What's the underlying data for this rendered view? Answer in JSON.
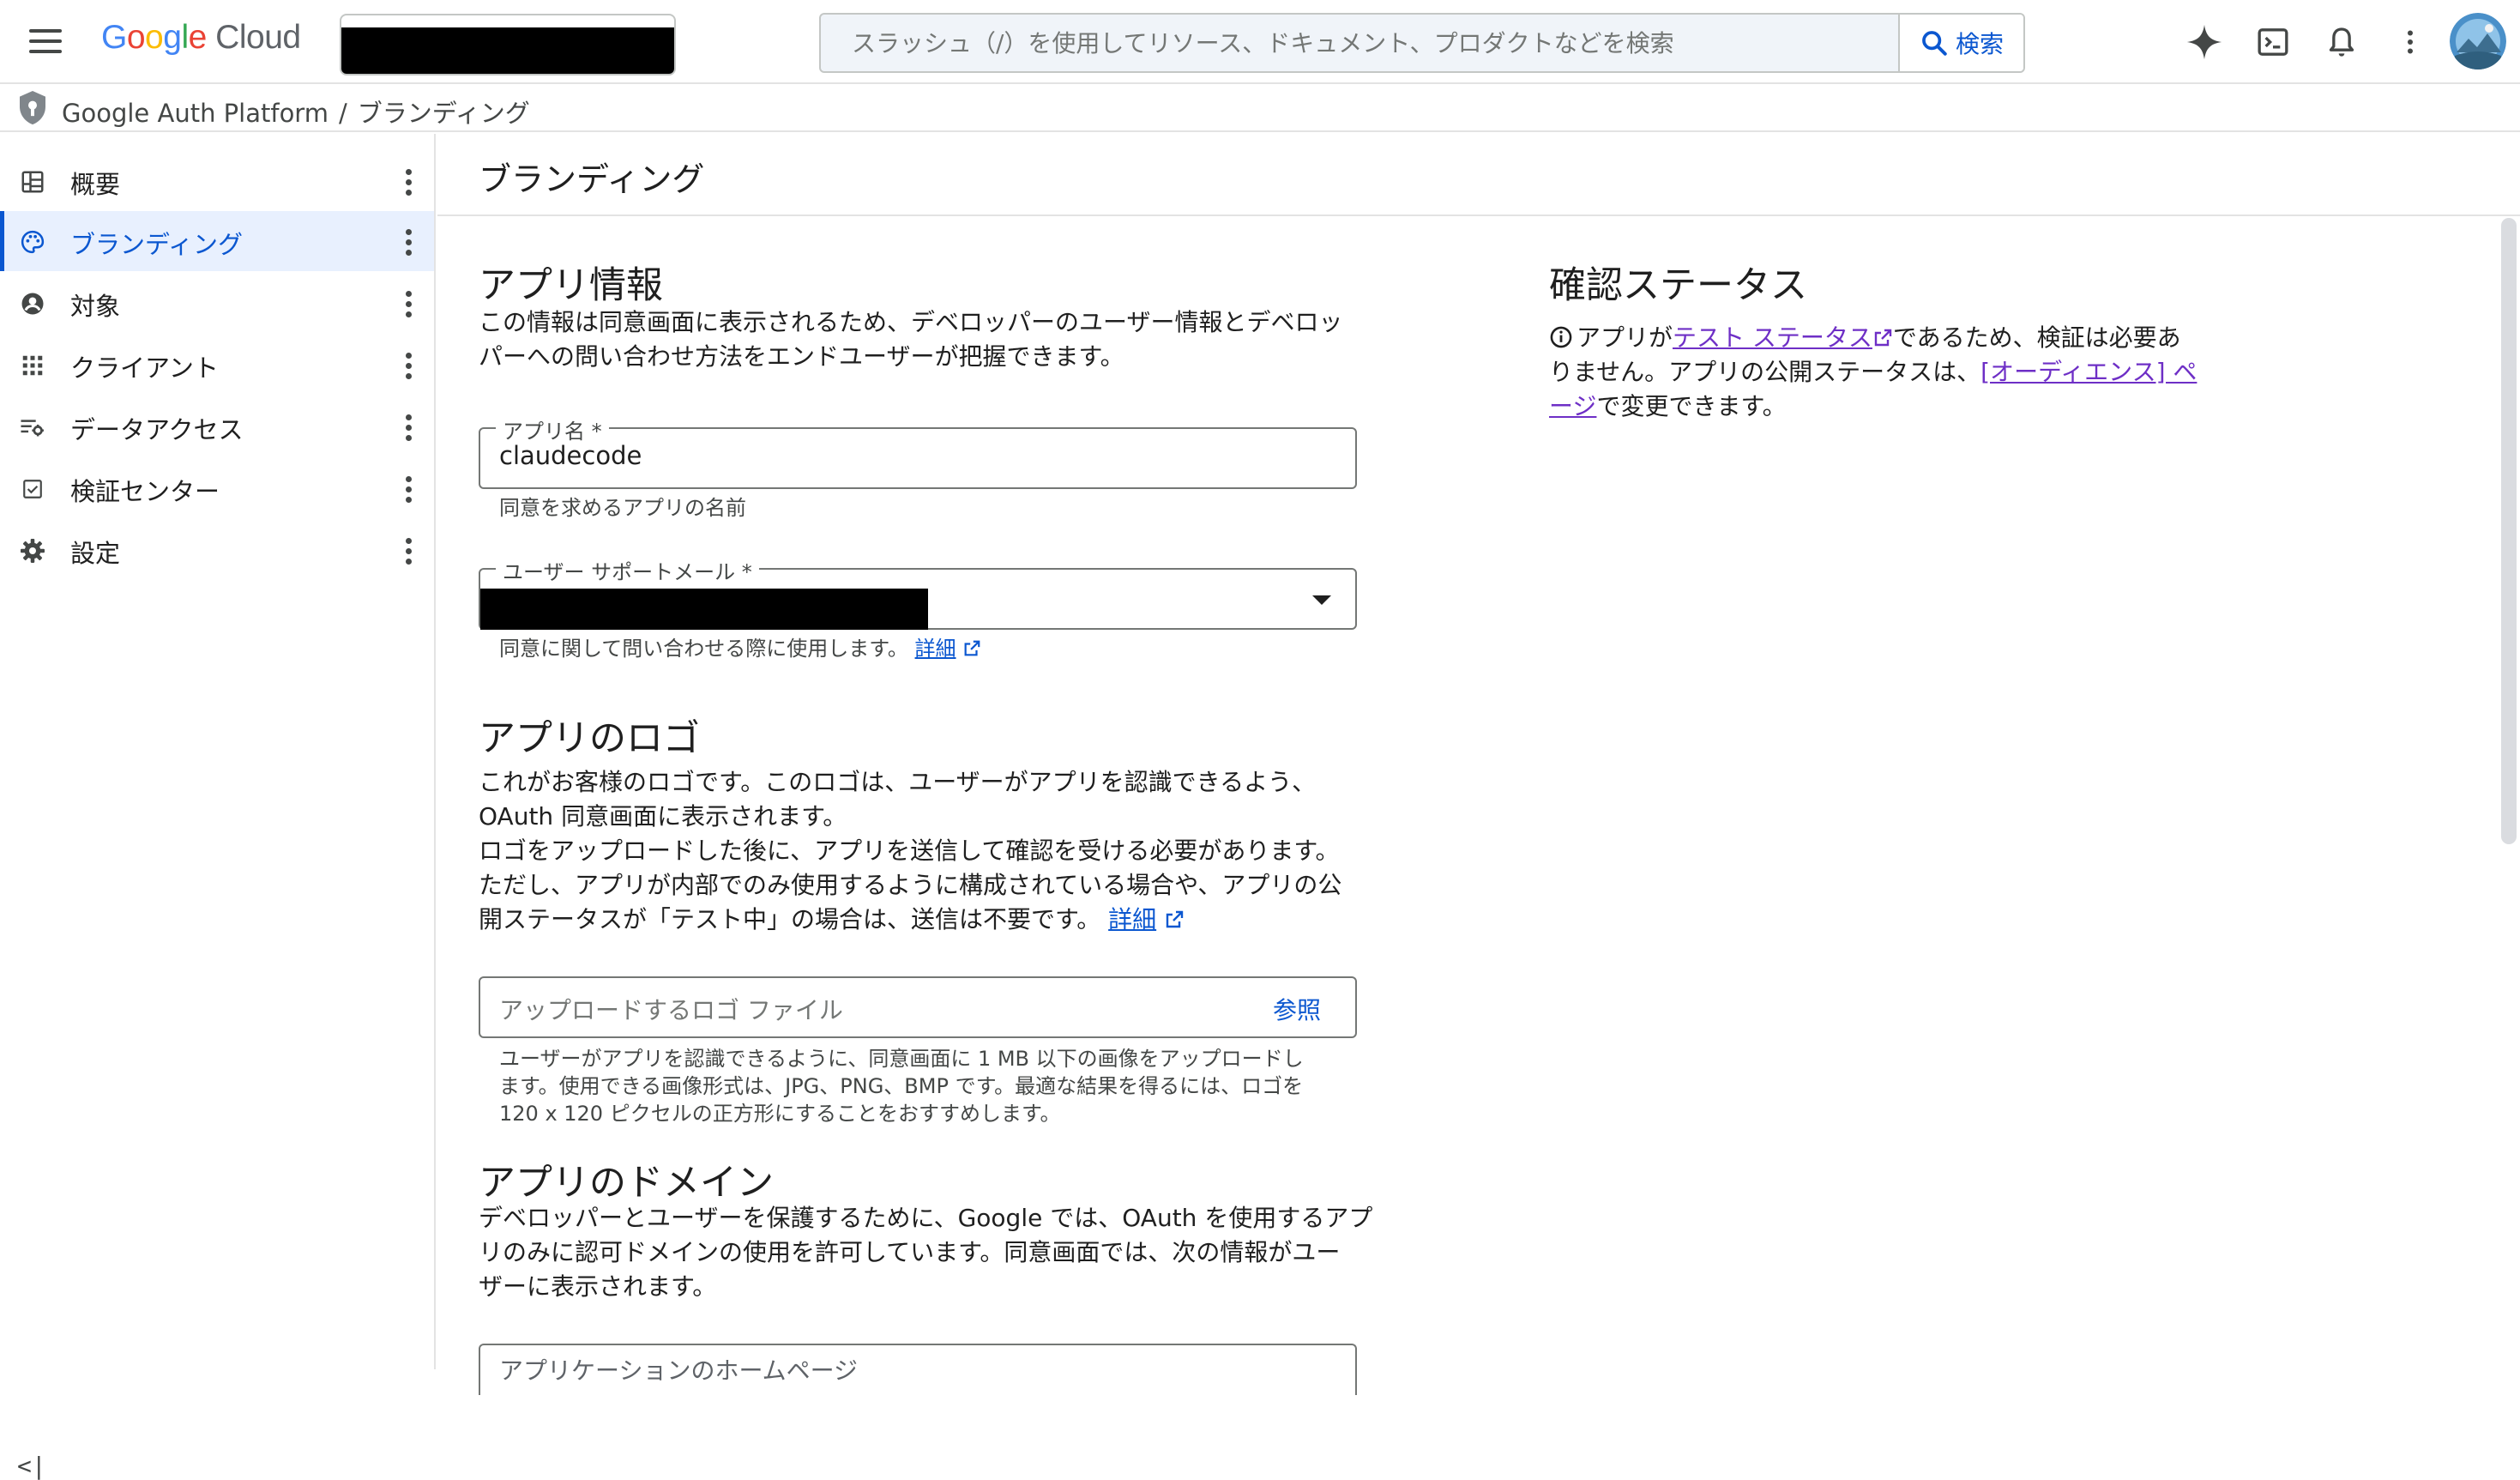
{
  "header": {
    "logo_google": "Google",
    "logo_cloud": "Cloud",
    "search_placeholder": "スラッシュ（/）を使用してリソース、ドキュメント、プロダクトなどを検索",
    "search_button": "検索"
  },
  "breadcrumb": {
    "root": "Google Auth Platform",
    "separator": "/",
    "current": "ブランディング"
  },
  "sidebar": {
    "items": [
      {
        "label": "概要",
        "icon": "dashboard-icon"
      },
      {
        "label": "ブランディング",
        "icon": "palette-icon",
        "active": true
      },
      {
        "label": "対象",
        "icon": "account-circle-icon"
      },
      {
        "label": "クライアント",
        "icon": "apps-grid-icon"
      },
      {
        "label": "データアクセス",
        "icon": "data-settings-icon"
      },
      {
        "label": "検証センター",
        "icon": "checkbox-icon"
      },
      {
        "label": "設定",
        "icon": "gear-icon"
      }
    ],
    "collapse_label": "<|"
  },
  "page": {
    "title": "ブランディング"
  },
  "app_info": {
    "heading": "アプリ情報",
    "description_line1": "この情報は同意画面に表示されるため、デベロッパーのユーザー情報とデベロッ",
    "description_line2": "パーへの問い合わせ方法をエンドユーザーが把握できます。",
    "app_name_label": "アプリ名 *",
    "app_name_value": "claudecode",
    "app_name_helper": "同意を求めるアプリの名前",
    "support_email_label": "ユーザー サポートメール *",
    "support_email_helper": "同意に関して問い合わせる際に使用します。",
    "support_email_link": "詳細"
  },
  "logo_section": {
    "heading": "アプリのロゴ",
    "line1": "これがお客様のロゴです。このロゴは、ユーザーがアプリを認識できるよう、",
    "line2": "OAuth 同意画面に表示されます。",
    "line3": "ロゴをアップロードした後に、アプリを送信して確認を受ける必要があります。",
    "line4": "ただし、アプリが内部でのみ使用するように構成されている場合や、アプリの公",
    "line5": "開ステータスが「テスト中」の場合は、送信は不要です。",
    "link": "詳細",
    "upload_placeholder": "アップロードするロゴ ファイル",
    "browse": "参照",
    "helper_line1": "ユーザーがアプリを認識できるように、同意画面に 1 MB 以下の画像をアップロードし",
    "helper_line2": "ます。使用できる画像形式は、JPG、PNG、BMP です。最適な結果を得るには、ロゴを",
    "helper_line3": "120 x 120 ピクセルの正方形にすることをおすすめします。"
  },
  "domain_section": {
    "heading": "アプリのドメイン",
    "line1": "デベロッパーとユーザーを保護するために、Google では、OAuth を使用するアプ",
    "line2": "リのみに認可ドメインの使用を許可しています。同意画面では、次の情報がユー",
    "line3": "ザーに表示されます。",
    "homepage_label": "アプリケーションのホームページ"
  },
  "verification": {
    "heading": "確認ステータス",
    "text_before": "アプリが",
    "status_link": "テスト ステータス",
    "text_after": "であるため、検証は必要あ",
    "line2_before": "りません。アプリの公開ステータスは、",
    "audience_link_part1": "[オーディエンス] ペ",
    "audience_link_part2": "ージ",
    "line3_after": "で変更できます。"
  },
  "colors": {
    "accent": "#0b57d0",
    "active_bg": "#e8f0fe",
    "visited_link": "#6e2fc6",
    "border": "#e3e3e3"
  }
}
